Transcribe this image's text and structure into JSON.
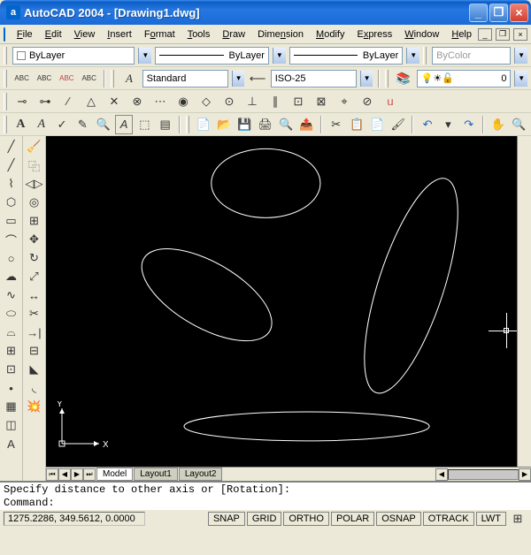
{
  "title": "AutoCAD 2004 - [Drawing1.dwg]",
  "menu": {
    "file": "File",
    "edit": "Edit",
    "view": "View",
    "insert": "Insert",
    "format": "Format",
    "tools": "Tools",
    "draw": "Draw",
    "dimension": "Dimension",
    "modify": "Modify",
    "express": "Express",
    "window": "Window",
    "help": "Help"
  },
  "layers": {
    "current": "ByLayer",
    "linetype": "ByLayer",
    "lineweight": "ByLayer",
    "color": "ByColor"
  },
  "textStyle": {
    "style": "Standard",
    "dimstyle": "ISO-25",
    "layerNum": "0"
  },
  "modelTabs": {
    "model": "Model",
    "layout1": "Layout1",
    "layout2": "Layout2"
  },
  "command": {
    "prev": "Specify distance to other axis or [Rotation]:",
    "prompt": "Command:"
  },
  "status": {
    "coords": "1275.2286, 349.5612, 0.0000",
    "snap": "SNAP",
    "grid": "GRID",
    "ortho": "ORTHO",
    "polar": "POLAR",
    "osnap": "OSNAP",
    "otrack": "OTRACK",
    "lwt": "LWT"
  },
  "ucs": {
    "x": "X",
    "y": "Y"
  }
}
